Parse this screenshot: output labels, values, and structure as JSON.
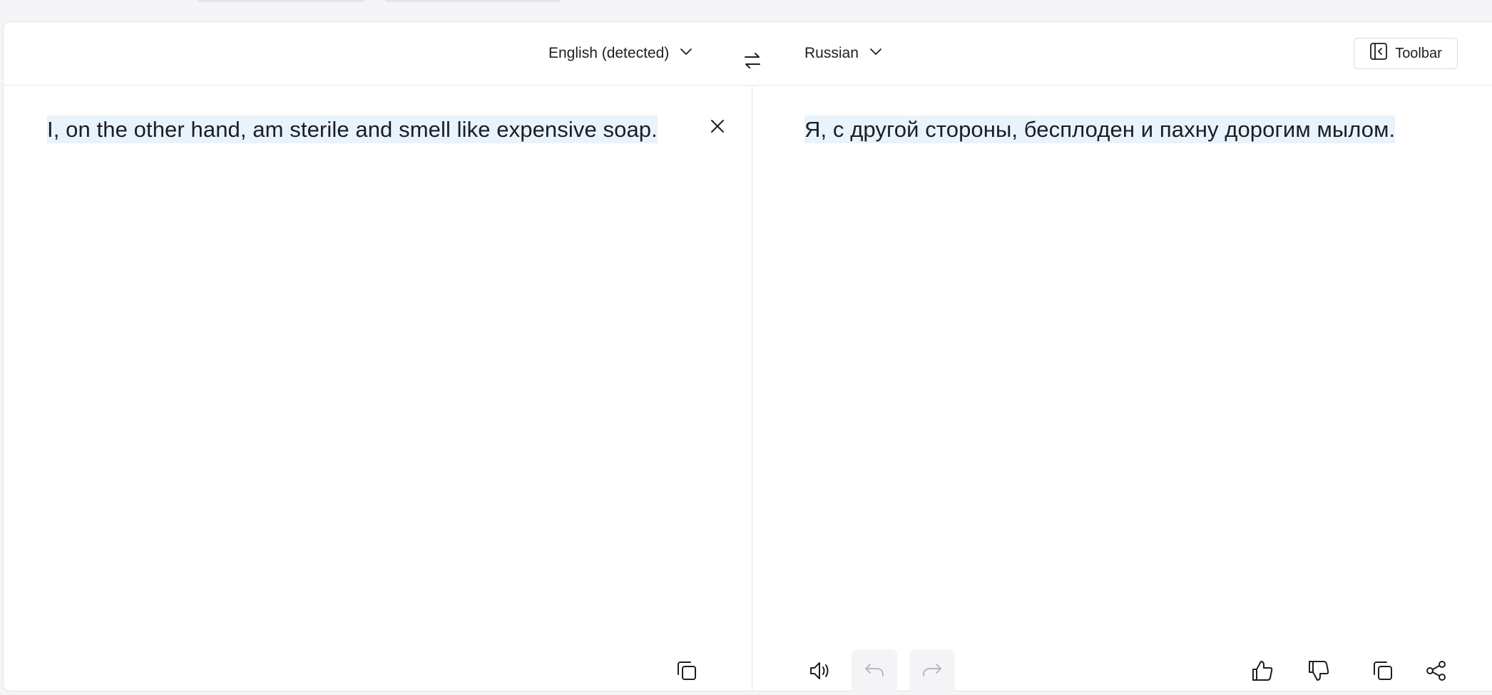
{
  "header": {
    "source_language": "English (detected)",
    "target_language": "Russian",
    "toolbar_label": "Toolbar"
  },
  "source": {
    "text": "I, on the other hand, am sterile and smell like expensive soap."
  },
  "target": {
    "text": "Я, с другой стороны, бесплоден и пахну дорогим мылом."
  },
  "icons": {
    "source_chevron": "chevron-down-icon",
    "target_chevron": "chevron-down-icon",
    "swap": "swap-arrows-icon",
    "toolbar": "sidebar-collapse-icon",
    "clear": "close-icon",
    "copy_source": "copy-icon",
    "speaker": "speaker-icon",
    "undo": "undo-icon",
    "redo": "redo-icon",
    "thumbs_up": "thumbs-up-icon",
    "thumbs_down": "thumbs-down-icon",
    "copy_target": "copy-icon",
    "share": "share-icon"
  },
  "colors": {
    "text": "#1b1e25",
    "highlight": "#e9f3fb",
    "disabled": "#b8b8be"
  }
}
